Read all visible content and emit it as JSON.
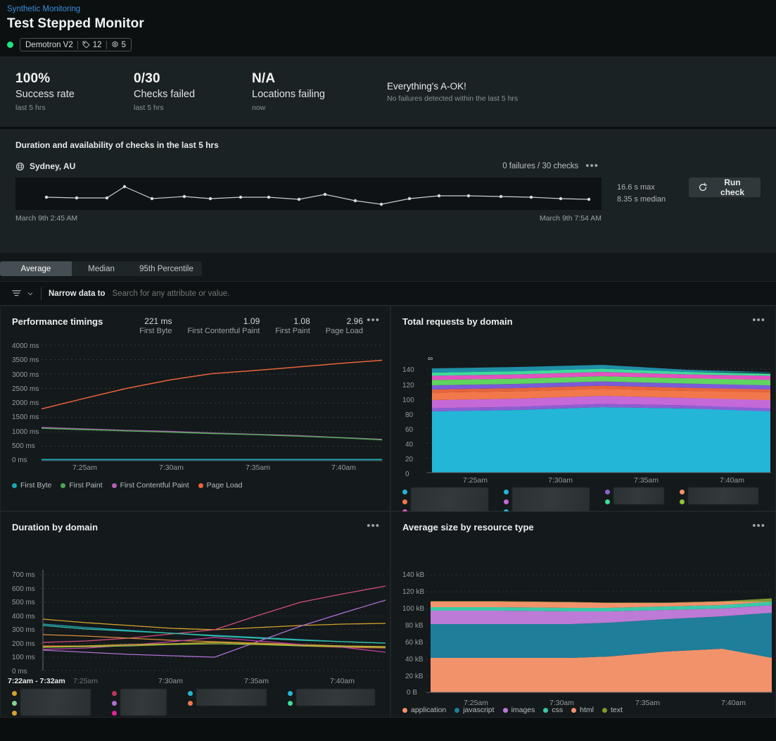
{
  "header": {
    "breadcrumb": "Synthetic Monitoring",
    "title": "Test Stepped Monitor",
    "entity_name": "Demotron V2",
    "tag_count": "12",
    "setting_count": "5",
    "status_color": "#1ce783"
  },
  "summary": {
    "items": [
      {
        "value": "100%",
        "label": "Success rate",
        "sub": "last 5 hrs"
      },
      {
        "value": "0/30",
        "label": "Checks failed",
        "sub": "last 5 hrs"
      },
      {
        "value": "N/A",
        "label": "Locations failing",
        "sub": "now"
      }
    ],
    "message_title": "Everything's A-OK!",
    "message_sub": "No failures detected within the last 5 hrs"
  },
  "duration_panel": {
    "title": "Duration and availability of checks in the last 5 hrs",
    "location": "Sydney, AU",
    "checks_text": "0 failures / 30 checks",
    "kebab": "•••",
    "start_time": "March 9th 2:45 AM",
    "end_time": "March 9th 7:54 AM",
    "max_stat": "16.6 s max",
    "median_stat": "8.35 s median",
    "run_check_label": "Run check"
  },
  "tabs": [
    {
      "label": "Average",
      "active": true
    },
    {
      "label": "Median",
      "active": false
    },
    {
      "label": "95th Percentile",
      "active": false
    }
  ],
  "filter": {
    "label": "Narrow data to",
    "placeholder": "Search for any attribute or value.",
    "value": ""
  },
  "cards": {
    "performance_timings": {
      "title": "Performance timings",
      "kebab": "•••",
      "metrics": [
        {
          "value": "221 ms",
          "label": "First Byte"
        },
        {
          "value": "1.09",
          "label": "First Contentful Paint"
        },
        {
          "value": "1.08",
          "label": "First Paint"
        },
        {
          "value": "2.96",
          "label": "Page Load"
        }
      ]
    },
    "total_requests": {
      "title": "Total requests by domain",
      "kebab": "•••",
      "corner_glyph": "∞"
    },
    "duration_by_domain": {
      "title": "Duration by domain",
      "kebab": "•••",
      "tooltip_range": "7:22am  -  7:32am"
    },
    "average_size": {
      "title": "Average size by resource type",
      "kebab": "•••"
    }
  },
  "chart_data": [
    {
      "id": "performance_timings",
      "type": "line",
      "title": "Performance timings",
      "xlabel": "",
      "ylabel": "",
      "ylim": [
        0,
        4000
      ],
      "ytick_labels": [
        "4000 ms",
        "3500 ms",
        "3000 ms",
        "2500 ms",
        "2000 ms",
        "1500 ms",
        "1000 ms",
        "500 ms",
        "0 ms"
      ],
      "ytick_values": [
        4000,
        3500,
        3000,
        2500,
        2000,
        1500,
        1000,
        500,
        0
      ],
      "xtick_labels": [
        "7:25am",
        "7:30am",
        "7:35am",
        "7:40am"
      ],
      "x": [
        0,
        0.125,
        0.25,
        0.375,
        0.5,
        0.625,
        0.75,
        0.875,
        1
      ],
      "grid": true,
      "legend_position": "bottom",
      "series": [
        {
          "name": "First Byte",
          "color": "#17a8b7",
          "values": [
            40,
            40,
            40,
            40,
            40,
            40,
            40,
            40,
            40
          ]
        },
        {
          "name": "First Paint",
          "color": "#4ca852",
          "values": [
            1120,
            1075,
            1030,
            985,
            940,
            900,
            850,
            790,
            720
          ]
        },
        {
          "name": "First Contentful Paint",
          "color": "#b35fb6",
          "values": [
            1150,
            1100,
            1055,
            1010,
            960,
            915,
            870,
            800,
            740
          ]
        },
        {
          "name": "Page Load",
          "color": "#e8643c",
          "values": [
            1790,
            2150,
            2500,
            2790,
            3010,
            3120,
            3240,
            3360,
            3470
          ]
        }
      ]
    },
    {
      "id": "total_requests_by_domain",
      "type": "area",
      "title": "Total requests by domain",
      "stacked": true,
      "ylim": [
        0,
        140
      ],
      "ytick_labels": [
        "140",
        "120",
        "100",
        "80",
        "60",
        "40",
        "20",
        "0"
      ],
      "ytick_values": [
        140,
        120,
        100,
        80,
        60,
        40,
        20,
        0
      ],
      "xtick_labels": [
        "7:25am",
        "7:30am",
        "7:35am",
        "7:40am"
      ],
      "grid": true,
      "legend_position": "bottom",
      "legend_redacted": true,
      "series": [
        {
          "name": "",
          "color": "#23b6d6",
          "values": [
            83,
            83,
            84,
            86,
            88,
            88,
            87,
            86,
            86
          ]
        },
        {
          "name": "",
          "color": "#8b5fd4",
          "values": [
            3,
            3,
            3,
            3,
            3,
            3,
            3,
            3,
            3
          ]
        },
        {
          "name": "",
          "color": "#c569d8",
          "values": [
            8,
            8,
            8,
            8,
            8,
            8,
            8,
            8,
            8
          ]
        },
        {
          "name": "",
          "color": "#f2784b",
          "values": [
            7,
            7,
            7,
            7,
            7,
            7,
            7,
            7,
            7
          ]
        },
        {
          "name": "",
          "color": "#e8643c",
          "values": [
            3,
            3,
            3,
            3,
            3,
            3,
            3,
            3,
            3
          ]
        },
        {
          "name": "",
          "color": "#7b5bd6",
          "values": [
            4,
            4,
            4,
            4,
            4,
            4,
            4,
            4,
            4
          ]
        },
        {
          "name": "",
          "color": "#5fd45f",
          "values": [
            5,
            5,
            5,
            5,
            5,
            5,
            5,
            5,
            5
          ]
        },
        {
          "name": "",
          "color": "#e252c0",
          "values": [
            4,
            4,
            4,
            4,
            4,
            4,
            4,
            4,
            4
          ]
        },
        {
          "name": "",
          "color": "#3ddc9a",
          "values": [
            3,
            3,
            3,
            3,
            3,
            3,
            3,
            2,
            2
          ]
        },
        {
          "name": "",
          "color": "#1f8fa8",
          "values": [
            4,
            4,
            4,
            4,
            3,
            3,
            2,
            2,
            2
          ]
        }
      ]
    },
    {
      "id": "duration_by_domain",
      "type": "line",
      "title": "Duration by domain",
      "ylim": [
        0,
        700
      ],
      "ytick_labels": [
        "700 ms",
        "600 ms",
        "500 ms",
        "400 ms",
        "300 ms",
        "200 ms",
        "100 ms",
        "0 ms"
      ],
      "ytick_values": [
        700,
        600,
        500,
        400,
        300,
        200,
        100,
        0
      ],
      "xtick_labels": [
        "7:25am",
        "7:30am",
        "7:35am",
        "7:40am"
      ],
      "grid": true,
      "legend_position": "bottom",
      "legend_redacted": true,
      "series": [
        {
          "name": "",
          "color": "#d4a32c",
          "values": [
            375,
            350,
            330,
            310,
            300,
            315,
            330,
            340,
            345
          ]
        },
        {
          "name": "",
          "color": "#d44d7a",
          "values": [
            205,
            215,
            235,
            265,
            300,
            400,
            500,
            560,
            615
          ]
        },
        {
          "name": "",
          "color": "#21a9bd",
          "values": [
            340,
            315,
            295,
            275,
            260,
            245,
            230,
            215,
            205
          ]
        },
        {
          "name": "",
          "color": "#32c4a8",
          "values": [
            330,
            305,
            288,
            270,
            255,
            240,
            225,
            212,
            200
          ]
        },
        {
          "name": "",
          "color": "#b06fd4",
          "values": [
            150,
            135,
            120,
            108,
            100,
            210,
            320,
            420,
            510
          ]
        },
        {
          "name": "",
          "color": "#d98f36",
          "values": [
            265,
            250,
            235,
            220,
            210,
            200,
            190,
            180,
            170
          ]
        },
        {
          "name": "",
          "color": "#e0503a",
          "values": [
            180,
            180,
            185,
            195,
            205,
            195,
            180,
            170,
            165
          ]
        },
        {
          "name": "",
          "color": "#c13fa8",
          "values": [
            152,
            165,
            185,
            210,
            240,
            215,
            190,
            170,
            135
          ]
        },
        {
          "name": "",
          "color": "#8fc441",
          "values": [
            170,
            175,
            182,
            190,
            198,
            190,
            180,
            172,
            168
          ]
        },
        {
          "name": "",
          "color": "#c2a634",
          "values": [
            175,
            180,
            188,
            196,
            205,
            196,
            186,
            178,
            172
          ]
        }
      ]
    },
    {
      "id": "average_size_by_resource_type",
      "type": "area",
      "title": "Average size by resource type",
      "stacked": true,
      "ylim": [
        0,
        140
      ],
      "ytick_labels": [
        "140 kB",
        "120 kB",
        "100 kB",
        "80 kB",
        "60 kB",
        "40 kB",
        "20 kB",
        "0 B"
      ],
      "ytick_values": [
        140,
        120,
        100,
        80,
        60,
        40,
        20,
        0
      ],
      "xtick_labels": [
        "7:25am",
        "7:30am",
        "7:35am",
        "7:40am"
      ],
      "grid": true,
      "legend_position": "bottom",
      "series": [
        {
          "name": "application",
          "color": "#f2926b",
          "values": [
            41,
            41,
            41,
            41,
            42,
            45,
            48,
            50,
            52
          ]
        },
        {
          "name": "javascript",
          "color": "#1f7e99",
          "values": [
            40,
            40,
            40,
            40,
            40,
            40,
            41,
            42,
            43
          ]
        },
        {
          "name": "images",
          "color": "#bd7ad6",
          "values": [
            16,
            16,
            16,
            16,
            15,
            13,
            11,
            10,
            9
          ]
        },
        {
          "name": "css",
          "color": "#3ac9a8",
          "values": [
            4,
            4,
            4,
            4,
            4,
            4,
            4,
            4,
            4
          ]
        },
        {
          "name": "html",
          "color": "#f2926b",
          "values": [
            7,
            7,
            7,
            7,
            7,
            6,
            5,
            4,
            3
          ]
        },
        {
          "name": "text",
          "color": "#7d9b2e",
          "values": [
            0.4,
            0.4,
            0.4,
            0.4,
            0.4,
            0.4,
            0.4,
            0.4,
            0.4
          ]
        }
      ]
    }
  ]
}
